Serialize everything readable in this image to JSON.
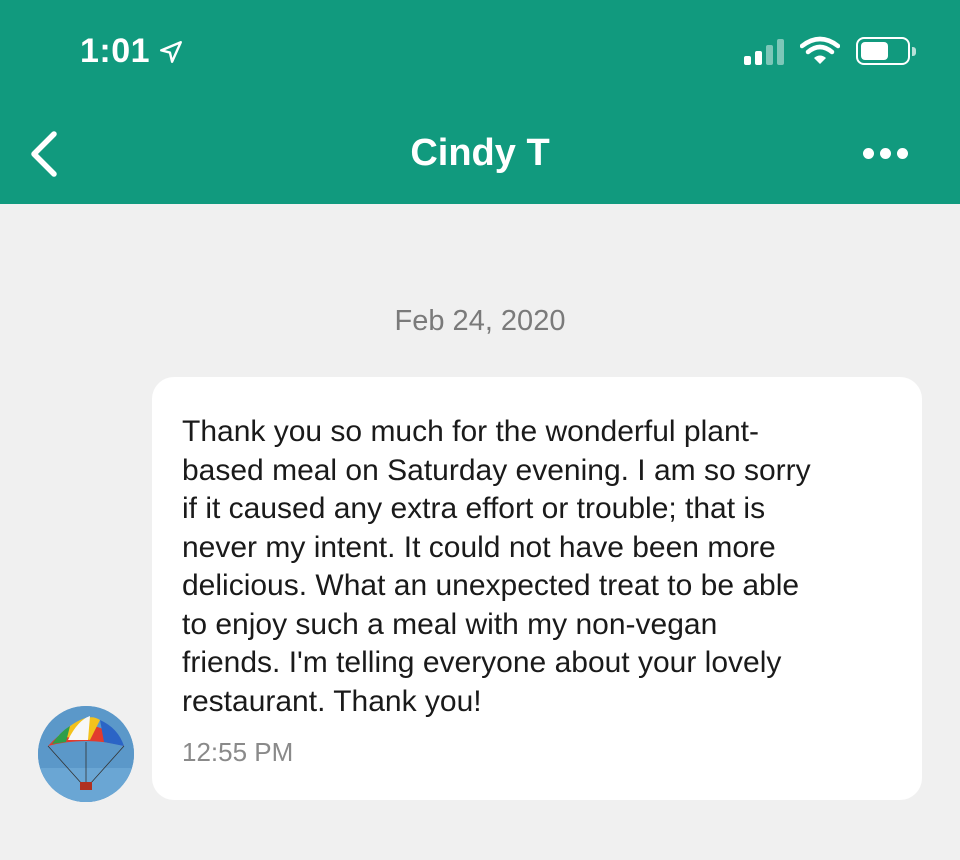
{
  "status_bar": {
    "time": "1:01",
    "location_icon": "location-arrow-icon",
    "signal_bars_active": 2,
    "signal_bars_total": 4,
    "battery_level": 0.62
  },
  "nav": {
    "back_icon": "chevron-left-icon",
    "title": "Cindy T",
    "more_icon": "more-horizontal-icon"
  },
  "conversation": {
    "date": "Feb 24, 2020",
    "messages": [
      {
        "text": "Thank you so much for the wonderful plant-\nbased meal on Saturday evening. I am so sorry\nif it caused any extra effort or trouble; that is\nnever my intent. It could not have been more\ndelicious. What an unexpected treat to be able\nto enjoy such a meal with my non-vegan\nfriends. I'm telling everyone about your lovely\nrestaurant. Thank you!",
        "time": "12:55 PM",
        "avatar": "parasail-photo"
      }
    ]
  },
  "colors": {
    "header": "#119a7e",
    "background": "#f0f0f0",
    "bubble": "#ffffff"
  }
}
